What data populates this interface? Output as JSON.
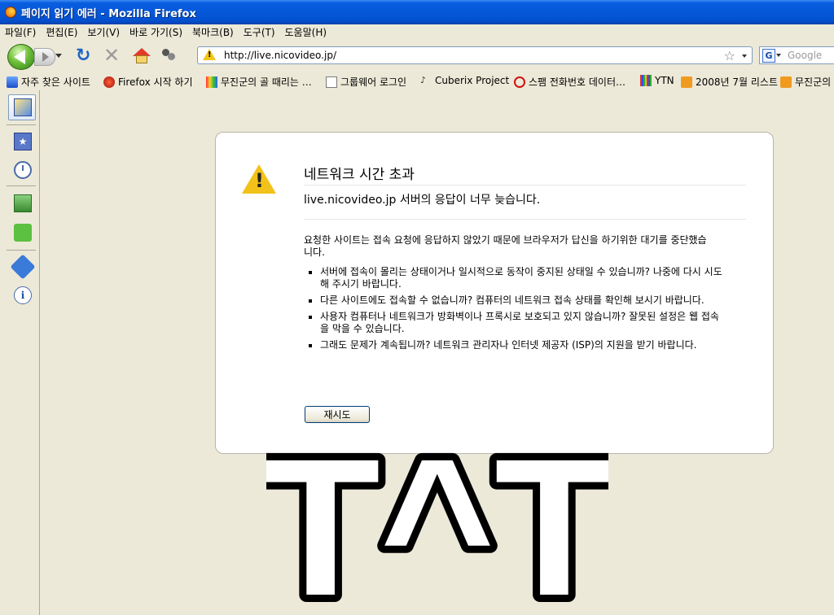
{
  "window": {
    "title": "페이지 읽기 에러 - Mozilla Firefox"
  },
  "menu": [
    "파일(F)",
    "편집(E)",
    "보기(V)",
    "바로 가기(S)",
    "북마크(B)",
    "도구(T)",
    "도움말(H)"
  ],
  "address": {
    "url": "http://live.nicovideo.jp/"
  },
  "search": {
    "engine_icon": "G",
    "placeholder": "Google"
  },
  "bookmarks": [
    {
      "label": "자주 찾은 사이트",
      "icon": "blue"
    },
    {
      "label": "Firefox 시작 하기",
      "icon": "red"
    },
    {
      "label": "무진군의 골 때리는 …",
      "icon": "multi"
    },
    {
      "label": "그룹웨어 로그인",
      "icon": "page"
    },
    {
      "label": "Cuberix Project",
      "icon": "note"
    },
    {
      "label": "스팸 전화번호 데이터…",
      "icon": "nored"
    },
    {
      "label": "YTN",
      "icon": "bars"
    },
    {
      "label": "2008년 7월 리스트",
      "icon": "rss"
    },
    {
      "label": "무진군의",
      "icon": "rss"
    }
  ],
  "error": {
    "title": "네트워크 시간 초과",
    "short_desc": "live.nicovideo.jp 서버의 응답이 너무 늦습니다.",
    "long_desc": "요청한 사이트는 접속 요청에 응답하지 않았기 때문에 브라우저가 답신을 하기위한 대기를 중단했습니다.",
    "reasons": [
      "서버에 접속이 몰리는 상태이거나 일시적으로 동작이 중지된 상태일 수 있습니까? 나중에 다시 시도해 주시기 바랍니다.",
      "다른 사이트에도 접속할 수 없습니까? 컴퓨터의 네트워크 접속 상태를 확인해 보시기 바랍니다.",
      "사용자 컴퓨터나 네트워크가 방화벽이나 프록시로 보호되고 있지 않습니까? 잘못된 설정은 웹 접속을 막을 수 있습니다.",
      "그래도 문제가 계속됩니까? 네트워크 관리자나 인터넷 제공자 (ISP)의 지원을 받기 바랍니다."
    ],
    "retry_label": "재시도"
  },
  "overlay_text": "T^T",
  "colors": {
    "titlebar": "#0458d8",
    "chrome": "#ece9d8",
    "warning": "#f2c21b"
  }
}
